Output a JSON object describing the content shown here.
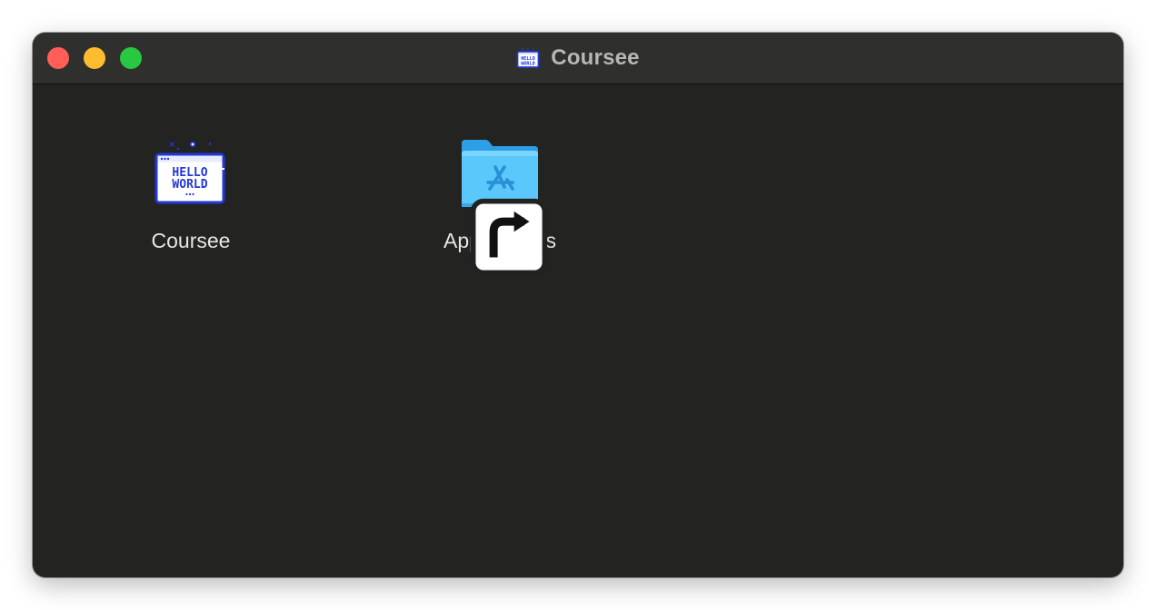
{
  "window": {
    "title": "Coursee",
    "title_icon": "hello-world-app-icon",
    "buttons": {
      "close_color": "#ff5f57",
      "minimize_color": "#febc2e",
      "maximize_color": "#28c840"
    }
  },
  "items": [
    {
      "label": "Coursee",
      "icon": "hello-world-app-icon",
      "icon_text_line1": "HELLO",
      "icon_text_line2": "WORLD"
    },
    {
      "label": "Applications",
      "icon": "applications-folder-alias-icon"
    }
  ],
  "colors": {
    "window_bg": "#232322",
    "titlebar_bg": "#2f2f2e",
    "title_text": "#b7b7b6",
    "label_text": "#e6e6e5",
    "app_icon_blue": "#2338d6",
    "folder_blue": "#5ac8fa"
  }
}
